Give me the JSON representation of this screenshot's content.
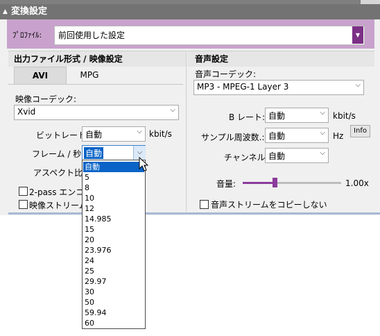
{
  "header": {
    "collapse_icon": "triangle-down",
    "title": "変換設定"
  },
  "profile": {
    "label": "ﾌﾟﾛﾌｧｲﾙ:",
    "value": "前回使用した設定"
  },
  "video": {
    "section_title": "出力ファイル形式 / 映像設定",
    "tabs": [
      {
        "label": "AVI",
        "active": true
      },
      {
        "label": "MPG",
        "active": false
      }
    ],
    "codec_label": "映像コーデック:",
    "codec_value": "Xvid",
    "bitrate_label": "ビットレート:",
    "bitrate_value": "自動",
    "bitrate_unit": "kbit/s",
    "framerate_label": "フレーム / 秒:",
    "framerate_value": "自動",
    "aspect_label": "アスペクト比:",
    "twopass_label": "2-pass エンコー",
    "copy_stream_label": "映像ストリーム"
  },
  "audio": {
    "section_title": "音声設定",
    "codec_label": "音声コーデック:",
    "codec_value": "MP3 - MPEG-1 Layer 3",
    "bitrate_label": "B レート:",
    "bitrate_value": "自動",
    "bitrate_unit": "kbit/s",
    "samplerate_label": "サンプル周波数.:",
    "samplerate_value": "自動",
    "samplerate_unit": "Hz",
    "info_button": "Info",
    "channel_label": "チャンネル:",
    "channel_value": "自動",
    "volume_label": "音量:",
    "volume_value": "1.00x",
    "volume_level_fraction": 0.32,
    "no_copy_label": "音声ストリームをコピーしない"
  },
  "framerate_dropdown": {
    "options": [
      "自動",
      "5",
      "8",
      "10",
      "12",
      "14.985",
      "15",
      "20",
      "23.976",
      "24",
      "25",
      "29.97",
      "30",
      "50",
      "59.94",
      "60"
    ],
    "selected_index": 0
  },
  "colors": {
    "accent": "#8b3b9b",
    "selection": "#0a64c8",
    "profile_bar": "#c8a2cc"
  }
}
